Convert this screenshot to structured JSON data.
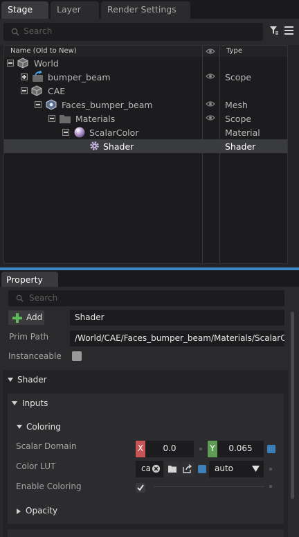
{
  "stage": {
    "tabs": [
      {
        "label": "Stage"
      },
      {
        "label": "Layer"
      },
      {
        "label": "Render Settings"
      }
    ],
    "search_placeholder": "Search",
    "columns": {
      "name": "Name (Old to New)",
      "type": "Type"
    },
    "rows": [
      {
        "label": "World",
        "type": ""
      },
      {
        "label": "bumper_beam",
        "type": "Scope"
      },
      {
        "label": "CAE",
        "type": ""
      },
      {
        "label": "Faces_bumper_beam",
        "type": "Mesh"
      },
      {
        "label": "Materials",
        "type": "Scope"
      },
      {
        "label": "ScalarColor",
        "type": "Material"
      },
      {
        "label": "Shader",
        "type": "Shader"
      }
    ],
    "accent_color": "#3d86c6"
  },
  "property": {
    "tab_label": "Property",
    "search_placeholder": "Search",
    "add_label": "Add",
    "prim_name": "Shader",
    "prim_path_label": "Prim Path",
    "prim_path_value": "/World/CAE/Faces_bumper_beam/Materials/ScalarColor/Shader",
    "instanceable_label": "Instanceable",
    "shader_section": "Shader",
    "inputs_section": "Inputs",
    "coloring_section": "Coloring",
    "scalar_domain_label": "Scalar Domain",
    "x_axis": "X",
    "x_value": "0.0",
    "y_axis": "Y",
    "y_value": "0.065",
    "color_lut_label": "Color LUT",
    "color_lut_value": "ca",
    "color_lut_mode": "auto",
    "enable_coloring_label": "Enable Coloring",
    "enable_coloring_checked": true,
    "opacity_section": "Opacity"
  }
}
